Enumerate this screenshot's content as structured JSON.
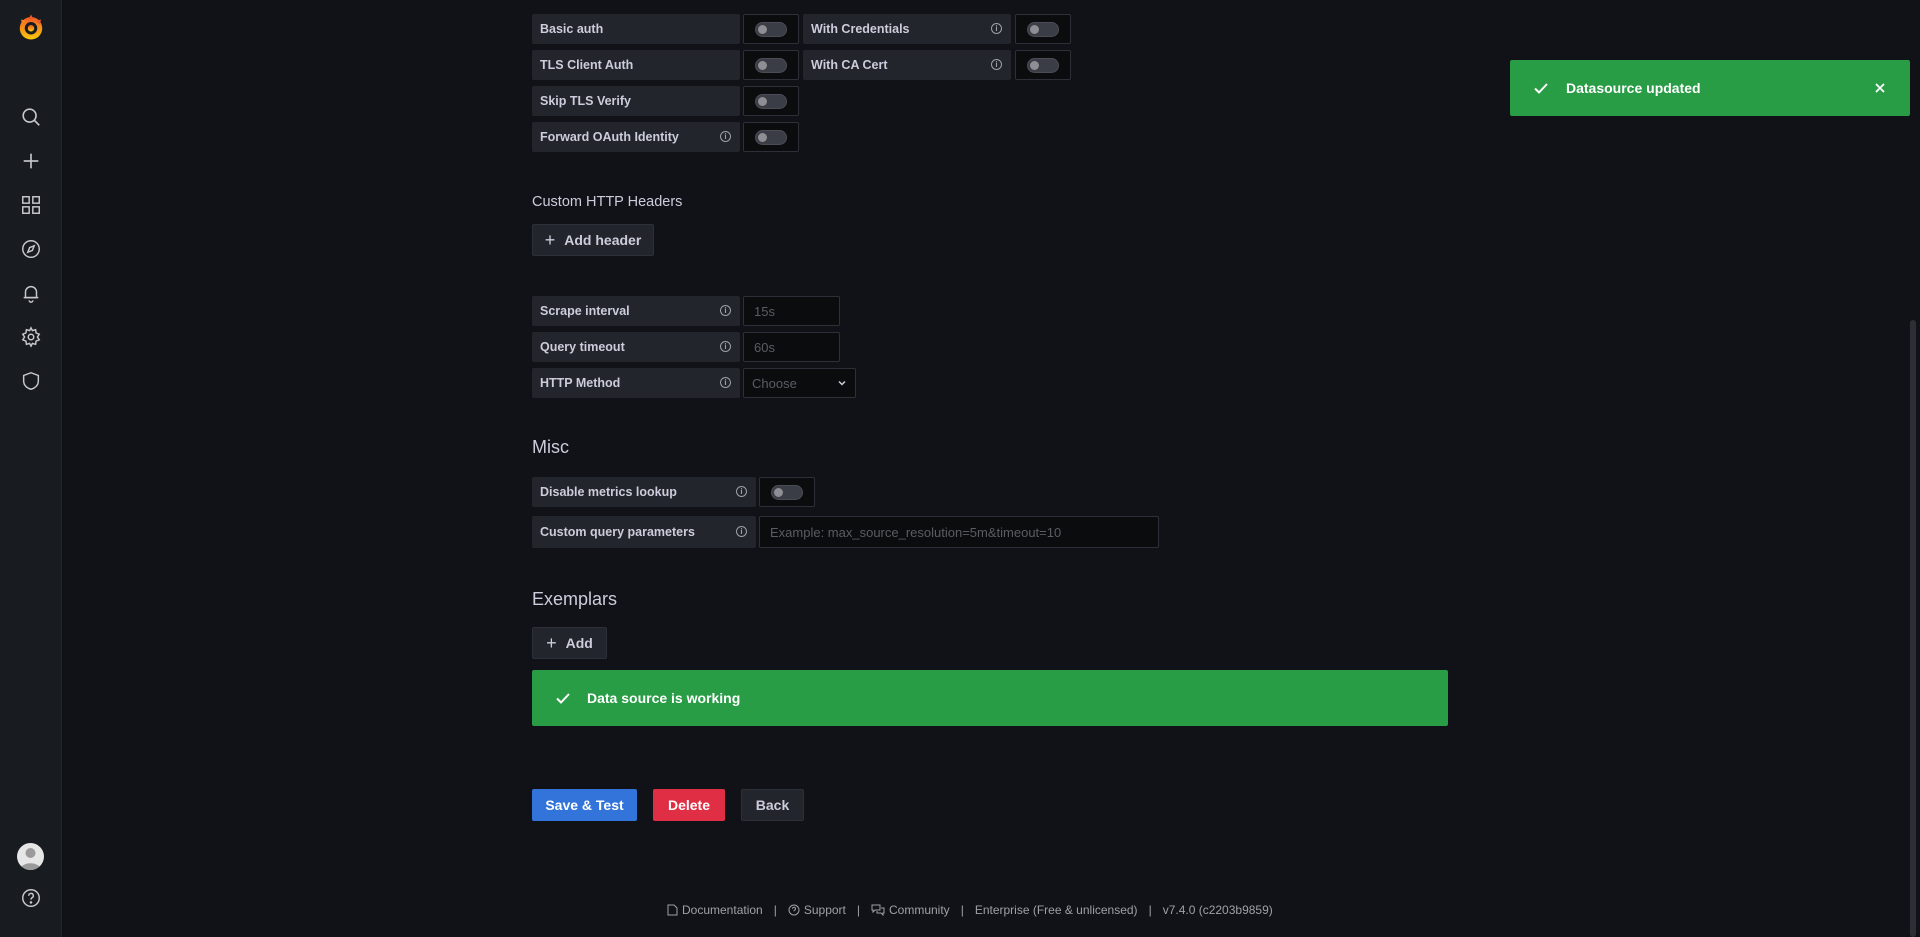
{
  "auth": {
    "basic_auth": "Basic auth",
    "with_credentials": "With Credentials",
    "tls_client_auth": "TLS Client Auth",
    "with_ca_cert": "With CA Cert",
    "skip_tls_verify": "Skip TLS Verify",
    "forward_oauth": "Forward OAuth Identity"
  },
  "headers": {
    "title": "Custom HTTP Headers",
    "add_label": "Add header"
  },
  "settings": {
    "scrape_interval_label": "Scrape interval",
    "scrape_interval_placeholder": "15s",
    "query_timeout_label": "Query timeout",
    "query_timeout_placeholder": "60s",
    "http_method_label": "HTTP Method",
    "http_method_value": "Choose"
  },
  "misc": {
    "title": "Misc",
    "disable_metrics_label": "Disable metrics lookup",
    "custom_query_label": "Custom query parameters",
    "custom_query_placeholder": "Example: max_source_resolution=5m&timeout=10"
  },
  "exemplars": {
    "title": "Exemplars",
    "add_label": "Add"
  },
  "status": {
    "message": "Data source is working"
  },
  "actions": {
    "save_label": "Save & Test",
    "delete_label": "Delete",
    "back_label": "Back"
  },
  "toast": {
    "message": "Datasource updated"
  },
  "footer": {
    "documentation": "Documentation",
    "support": "Support",
    "community": "Community",
    "edition": "Enterprise (Free & unlicensed)",
    "version": "v7.4.0 (c2203b9859)"
  },
  "colors": {
    "success": "#299c46",
    "primary": "#3274d9",
    "destructive": "#d44a3a",
    "background": "#111217"
  },
  "icons": [
    "grafana-logo-icon",
    "search-icon",
    "plus-icon",
    "dashboards-icon",
    "explore-icon",
    "alert-bell-icon",
    "gear-icon",
    "shield-icon",
    "avatar",
    "help-icon"
  ]
}
